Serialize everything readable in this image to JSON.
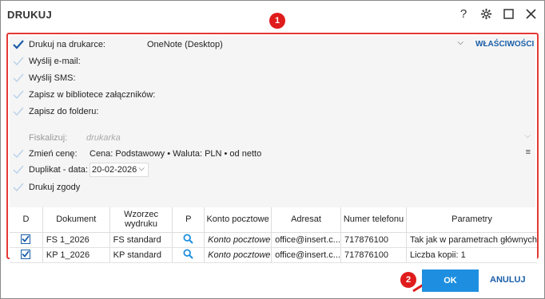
{
  "window": {
    "title": "DRUKUJ"
  },
  "markers": {
    "m1": "1",
    "m2": "2"
  },
  "options": {
    "print_on_printer": {
      "label": "Drukuj na drukarce:",
      "value": "OneNote (Desktop)",
      "link": "WŁAŚCIWOŚCI",
      "checked": true
    },
    "send_email": {
      "label": "Wyślij e-mail:",
      "checked": false
    },
    "send_sms": {
      "label": "Wyślij SMS:",
      "checked": false
    },
    "save_attachments": {
      "label": "Zapisz w bibliotece załączników:",
      "checked": false
    },
    "save_folder": {
      "label": "Zapisz do folderu:",
      "checked": false
    },
    "fiscalize": {
      "label": "Fiskalizuj:",
      "value": "drukarka"
    },
    "change_price": {
      "label": "Zmień cenę:",
      "value": "Cena: Podstawowy • Waluta: PLN • od netto",
      "checked": false
    },
    "duplicate": {
      "label": "Duplikat - data:",
      "value": "20-02-2026",
      "checked": false
    },
    "print_consents": {
      "label": "Drukuj zgody",
      "checked": false
    }
  },
  "table": {
    "headers": [
      "D",
      "Dokument",
      "Wzorzec wydruku",
      "P",
      "Konto pocztowe",
      "Adresat",
      "Numer telefonu",
      "Parametry"
    ],
    "rows": [
      {
        "checked": true,
        "document": "FS 1_2026",
        "template": "FS standard",
        "account_placeholder": "Konto pocztowe",
        "recipient": "office@insert.c...",
        "phone": "717876100",
        "params": "Tak jak w parametrach głównych"
      },
      {
        "checked": true,
        "document": "KP 1_2026",
        "template": "KP standard",
        "account_placeholder": "Konto pocztowe",
        "recipient": "office@insert.c...",
        "phone": "717876100",
        "params": "Liczba kopii: 1"
      }
    ]
  },
  "buttons": {
    "ok": "OK",
    "cancel": "ANULUJ"
  },
  "colors": {
    "accent": "#1e8fe0",
    "link": "#1a5ea8",
    "highlight": "#e53935"
  },
  "icons": [
    "help-icon",
    "gear-icon",
    "maximize-icon",
    "close-icon",
    "checkmark-icon",
    "search-icon",
    "chevron-down-icon",
    "menu-icon",
    "arrow-pointer-icon"
  ]
}
